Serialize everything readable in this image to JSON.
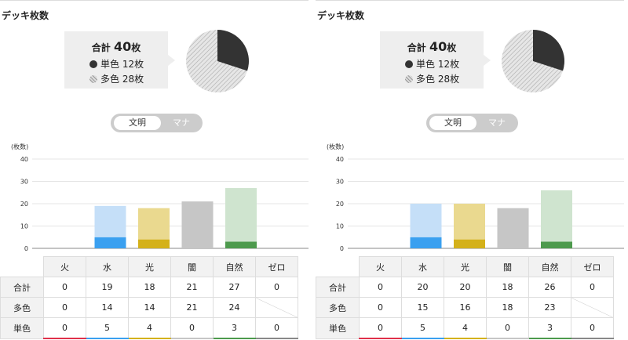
{
  "colors": {
    "fire": "#e0304a",
    "water_light": "#c5dff8",
    "water_dark": "#3aa0f0",
    "light_light": "#ead98f",
    "light_dark": "#d4b11a",
    "dark": "#c6c6c6",
    "nature_light": "#cfe4cf",
    "nature_dark": "#4d9a4d",
    "zero": "#888888",
    "pie_mono": "#333333",
    "pie_multi": "#d9d9d9"
  },
  "panels": [
    {
      "title": "デッキ枚数",
      "summary": {
        "total_label": "合計",
        "total_value": "40",
        "unit": "枚",
        "mono_label": "単色",
        "mono_value": "12枚",
        "multi_label": "多色",
        "multi_value": "28枚"
      },
      "toggle": {
        "active": "文明",
        "inactive": "マナ"
      },
      "chart_data": {
        "type": "bar",
        "ylabel": "(枚数)",
        "ylim": [
          0,
          40
        ],
        "yticks": [
          0,
          10,
          20,
          30,
          40
        ],
        "categories": [
          "火",
          "水",
          "光",
          "闇",
          "自然",
          "ゼロ"
        ],
        "series": [
          {
            "name": "単色",
            "values": [
              0,
              5,
              4,
              0,
              3,
              0
            ]
          },
          {
            "name": "多色",
            "values": [
              0,
              14,
              14,
              21,
              24,
              0
            ]
          }
        ],
        "pie": {
          "mono": 12,
          "multi": 28
        }
      },
      "table": {
        "columns": [
          "火",
          "水",
          "光",
          "闇",
          "自然",
          "ゼロ"
        ],
        "rows": [
          {
            "label": "合計",
            "values": [
              "0",
              "19",
              "18",
              "21",
              "27",
              "0"
            ]
          },
          {
            "label": "多色",
            "values": [
              "0",
              "14",
              "14",
              "21",
              "24",
              ""
            ]
          },
          {
            "label": "単色",
            "values": [
              "0",
              "5",
              "4",
              "0",
              "3",
              "0"
            ]
          }
        ]
      }
    },
    {
      "title": "デッキ枚数",
      "summary": {
        "total_label": "合計",
        "total_value": "40",
        "unit": "枚",
        "mono_label": "単色",
        "mono_value": "12枚",
        "multi_label": "多色",
        "multi_value": "28枚"
      },
      "toggle": {
        "active": "文明",
        "inactive": "マナ"
      },
      "chart_data": {
        "type": "bar",
        "ylabel": "(枚数)",
        "ylim": [
          0,
          40
        ],
        "yticks": [
          0,
          10,
          20,
          30,
          40
        ],
        "categories": [
          "火",
          "水",
          "光",
          "闇",
          "自然",
          "ゼロ"
        ],
        "series": [
          {
            "name": "単色",
            "values": [
              0,
              5,
              4,
              0,
              3,
              0
            ]
          },
          {
            "name": "多色",
            "values": [
              0,
              15,
              16,
              18,
              23,
              0
            ]
          }
        ],
        "pie": {
          "mono": 12,
          "multi": 28
        }
      },
      "table": {
        "columns": [
          "火",
          "水",
          "光",
          "闇",
          "自然",
          "ゼロ"
        ],
        "rows": [
          {
            "label": "合計",
            "values": [
              "0",
              "20",
              "20",
              "18",
              "26",
              "0"
            ]
          },
          {
            "label": "多色",
            "values": [
              "0",
              "15",
              "16",
              "18",
              "23",
              ""
            ]
          },
          {
            "label": "単色",
            "values": [
              "0",
              "5",
              "4",
              "0",
              "3",
              "0"
            ]
          }
        ]
      }
    }
  ]
}
